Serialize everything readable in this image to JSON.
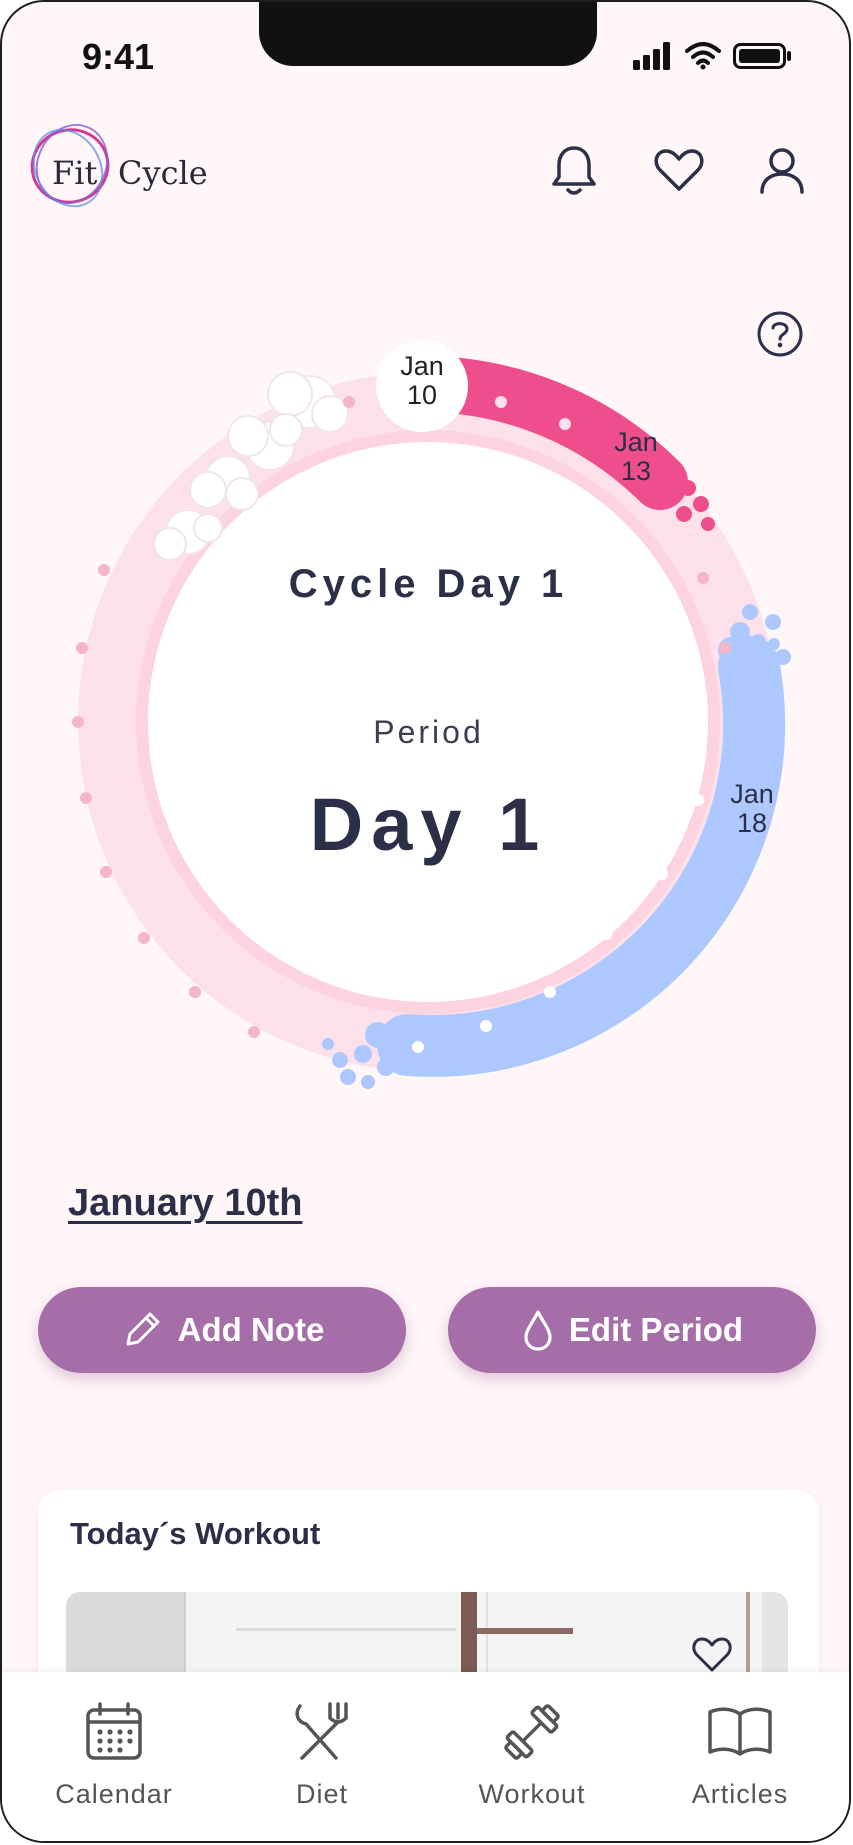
{
  "status_bar": {
    "time": "9:41"
  },
  "header": {
    "logo_fit": "Fit",
    "logo_cycle": "Cycle",
    "icons": [
      "bell-icon",
      "heart-icon",
      "profile-icon"
    ]
  },
  "cycle": {
    "title": "Cycle Day 1",
    "phase_label": "Period",
    "phase_day": "Day 1",
    "markers": [
      {
        "month": "Jan",
        "day": "10"
      },
      {
        "month": "Jan",
        "day": "13"
      },
      {
        "month": "Jan",
        "day": "18"
      }
    ],
    "colors": {
      "period": "#ee4f8c",
      "fertile": "#adc8ff",
      "ring": "#fcdbe6",
      "inner": "#ffffff"
    }
  },
  "selected_date": "January 10th",
  "actions": {
    "add_note": "Add Note",
    "edit_period": "Edit Period"
  },
  "workout": {
    "title": "Today´s Workout"
  },
  "tabs": [
    {
      "label": "Calendar",
      "icon": "calendar-icon"
    },
    {
      "label": "Diet",
      "icon": "diet-icon"
    },
    {
      "label": "Workout",
      "icon": "dumbbell-icon"
    },
    {
      "label": "Articles",
      "icon": "book-icon"
    }
  ],
  "accent_color": "#a66ea8"
}
